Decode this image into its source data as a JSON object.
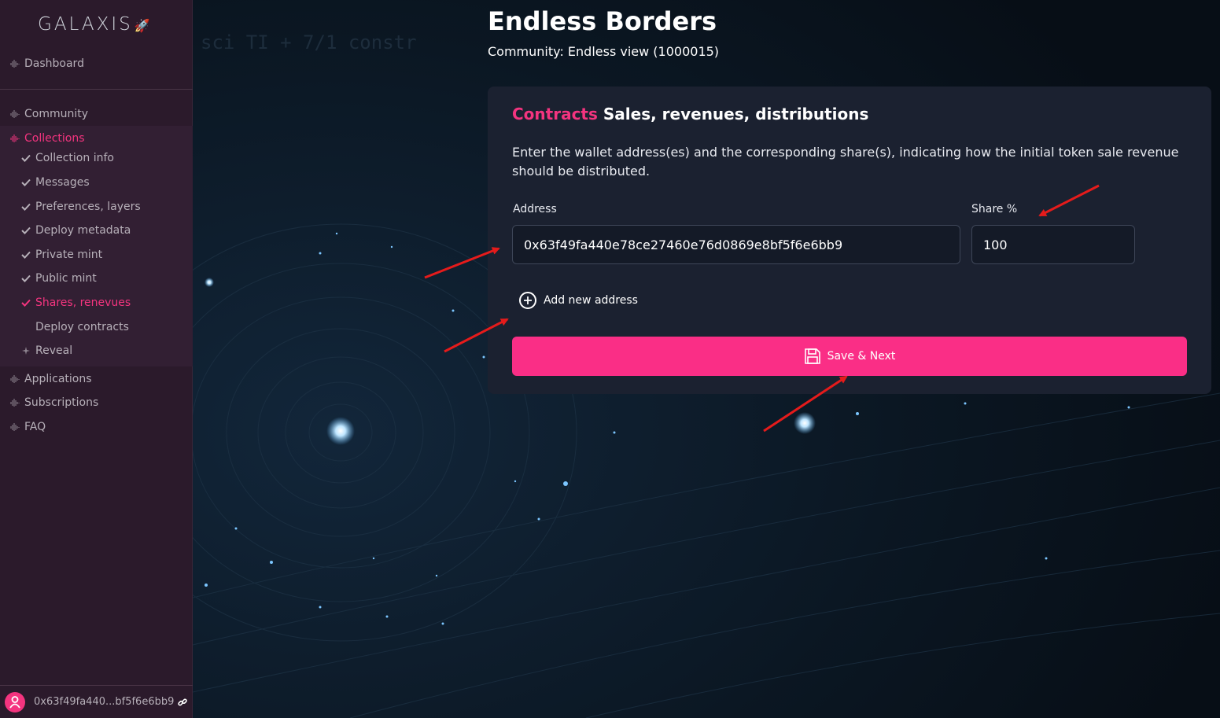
{
  "sidebar": {
    "logo": "GALAXIS",
    "items": [
      {
        "label": "Dashboard",
        "icon": "pulse-icon"
      },
      {
        "label": "Community",
        "icon": "pulse-icon"
      },
      {
        "label": "Collections",
        "icon": "pulse-icon",
        "active": true
      },
      {
        "label": "Applications",
        "icon": "pulse-icon"
      },
      {
        "label": "Subscriptions",
        "icon": "pulse-icon"
      },
      {
        "label": "FAQ",
        "icon": "pulse-icon"
      }
    ],
    "collection_steps": [
      {
        "label": "Collection info",
        "state": "done"
      },
      {
        "label": "Messages",
        "state": "done"
      },
      {
        "label": "Preferences, layers",
        "state": "done"
      },
      {
        "label": "Deploy metadata",
        "state": "done"
      },
      {
        "label": "Private mint",
        "state": "done"
      },
      {
        "label": "Public mint",
        "state": "done"
      },
      {
        "label": "Shares, renevues",
        "state": "current"
      },
      {
        "label": "Deploy contracts",
        "state": "pending"
      },
      {
        "label": "Reveal",
        "state": "locked"
      }
    ],
    "wallet": "0x63f49fa440...bf5f6e6bb9"
  },
  "header": {
    "title": "Endless Borders",
    "subtitle": "Community: Endless view (1000015)"
  },
  "card": {
    "title_accent": "Contracts",
    "title_rest": "Sales, revenues, distributions",
    "description": "Enter the wallet address(es) and the corresponding share(s), indicating how the initial token sale revenue should be distributed.",
    "address_label": "Address",
    "share_label": "Share %",
    "address_value": "0x63f49fa440e78ce27460e76d0869e8bf5f6e6bb9",
    "share_value": "100",
    "add_address_label": "Add new address",
    "save_label": "Save & Next"
  },
  "colors": {
    "accent": "#f4347f",
    "button": "#fa2e86",
    "sidebar_bg": "#2b1a2b",
    "card_bg": "#1b2130",
    "annotation_arrow": "#e51b1b"
  }
}
